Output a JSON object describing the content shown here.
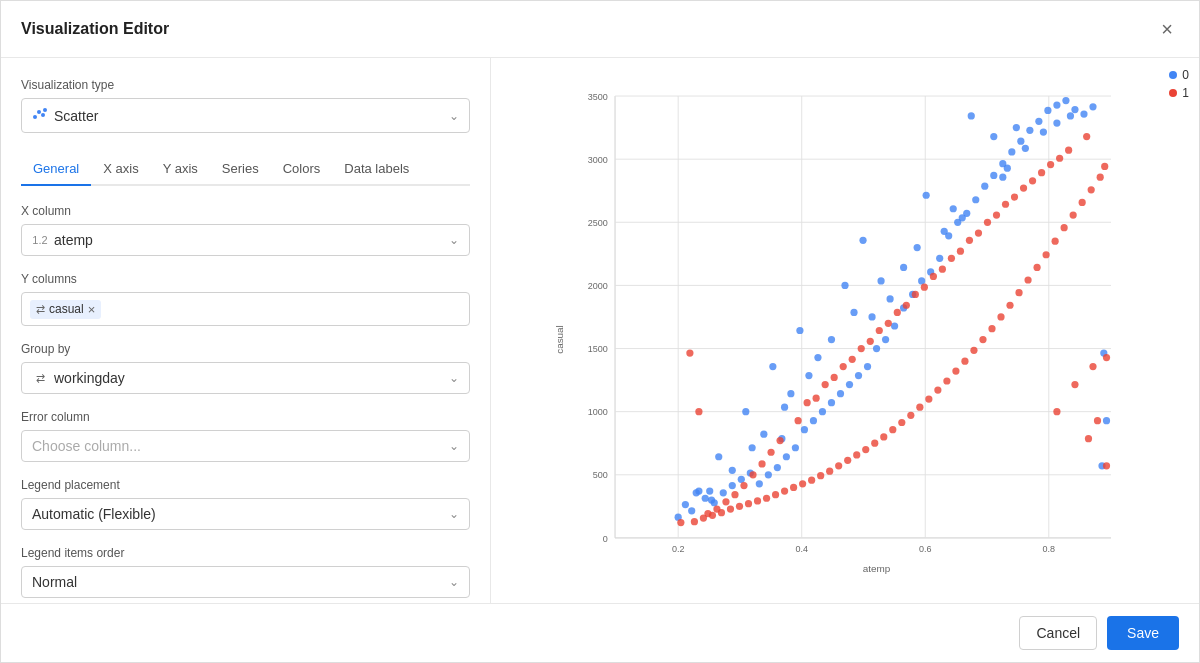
{
  "dialog": {
    "title": "Visualization Editor",
    "close_label": "×"
  },
  "viz_type": {
    "label": "Visualization type",
    "value": "Scatter",
    "icon": "scatter-icon"
  },
  "tabs": [
    {
      "label": "General",
      "active": true
    },
    {
      "label": "X axis",
      "active": false
    },
    {
      "label": "Y axis",
      "active": false
    },
    {
      "label": "Series",
      "active": false
    },
    {
      "label": "Colors",
      "active": false
    },
    {
      "label": "Data labels",
      "active": false
    }
  ],
  "x_column": {
    "label": "X column",
    "value": "atemp",
    "type_icon": "1.2"
  },
  "y_columns": {
    "label": "Y columns",
    "tags": [
      {
        "label": "casual",
        "type_icon": "⇄"
      }
    ]
  },
  "group_by": {
    "label": "Group by",
    "value": "workingday",
    "type_icon": "⇄"
  },
  "error_column": {
    "label": "Error column",
    "placeholder": "Choose column..."
  },
  "legend_placement": {
    "label": "Legend placement",
    "value": "Automatic (Flexible)"
  },
  "legend_items_order": {
    "label": "Legend items order",
    "value": "Normal"
  },
  "chart": {
    "x_axis_label": "atemp",
    "y_axis_label": "casual",
    "x_ticks": [
      "0.2",
      "0.4",
      "0.6",
      "0.8"
    ],
    "y_ticks": [
      "0",
      "500",
      "1000",
      "1500",
      "2000",
      "2500",
      "3000",
      "3500"
    ],
    "legend": [
      {
        "label": "0",
        "color": "#4285f4"
      },
      {
        "label": "1",
        "color": "#ea4335"
      }
    ]
  },
  "footer": {
    "cancel_label": "Cancel",
    "save_label": "Save"
  }
}
